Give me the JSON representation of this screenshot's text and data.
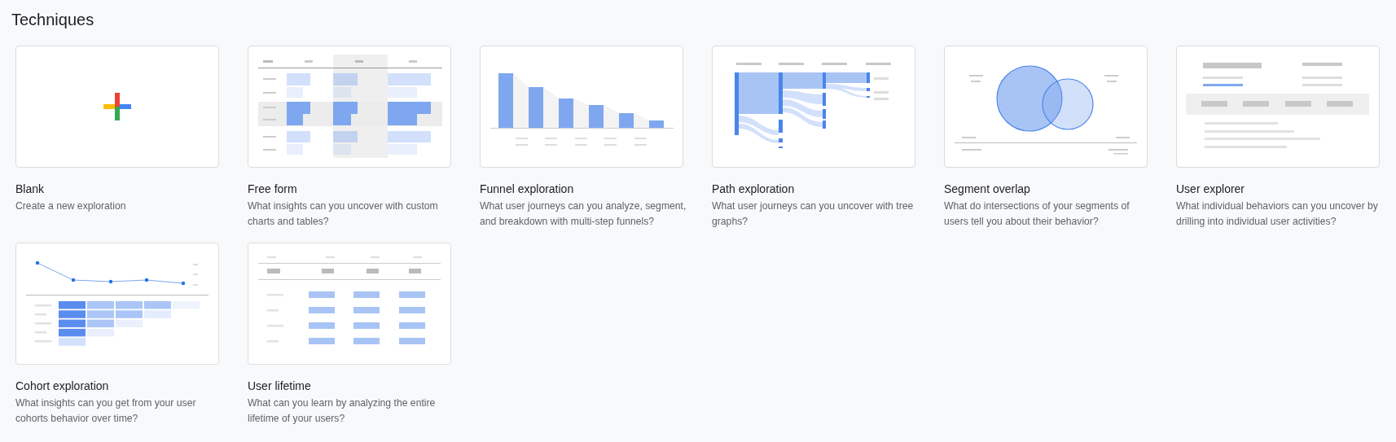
{
  "title": "Techniques",
  "techniques": [
    {
      "kind": "blank",
      "title": "Blank",
      "description": "Create a new exploration"
    },
    {
      "kind": "free_form",
      "title": "Free form",
      "description": "What insights can you uncover with custom charts and tables?"
    },
    {
      "kind": "funnel",
      "title": "Funnel exploration",
      "description": "What user journeys can you analyze, segment, and breakdown with multi-step funnels?"
    },
    {
      "kind": "path",
      "title": "Path exploration",
      "description": "What user journeys can you uncover with tree graphs?"
    },
    {
      "kind": "segment_overlap",
      "title": "Segment overlap",
      "description": "What do intersections of your segments of users tell you about their behavior?"
    },
    {
      "kind": "user_explorer",
      "title": "User explorer",
      "description": "What individual behaviors can you uncover by drilling into individual user activities?"
    },
    {
      "kind": "cohort",
      "title": "Cohort exploration",
      "description": "What insights can you get from your user cohorts behavior over time?"
    },
    {
      "kind": "user_lifetime",
      "title": "User lifetime",
      "description": "What can you learn by analyzing the entire lifetime of your users?"
    }
  ]
}
